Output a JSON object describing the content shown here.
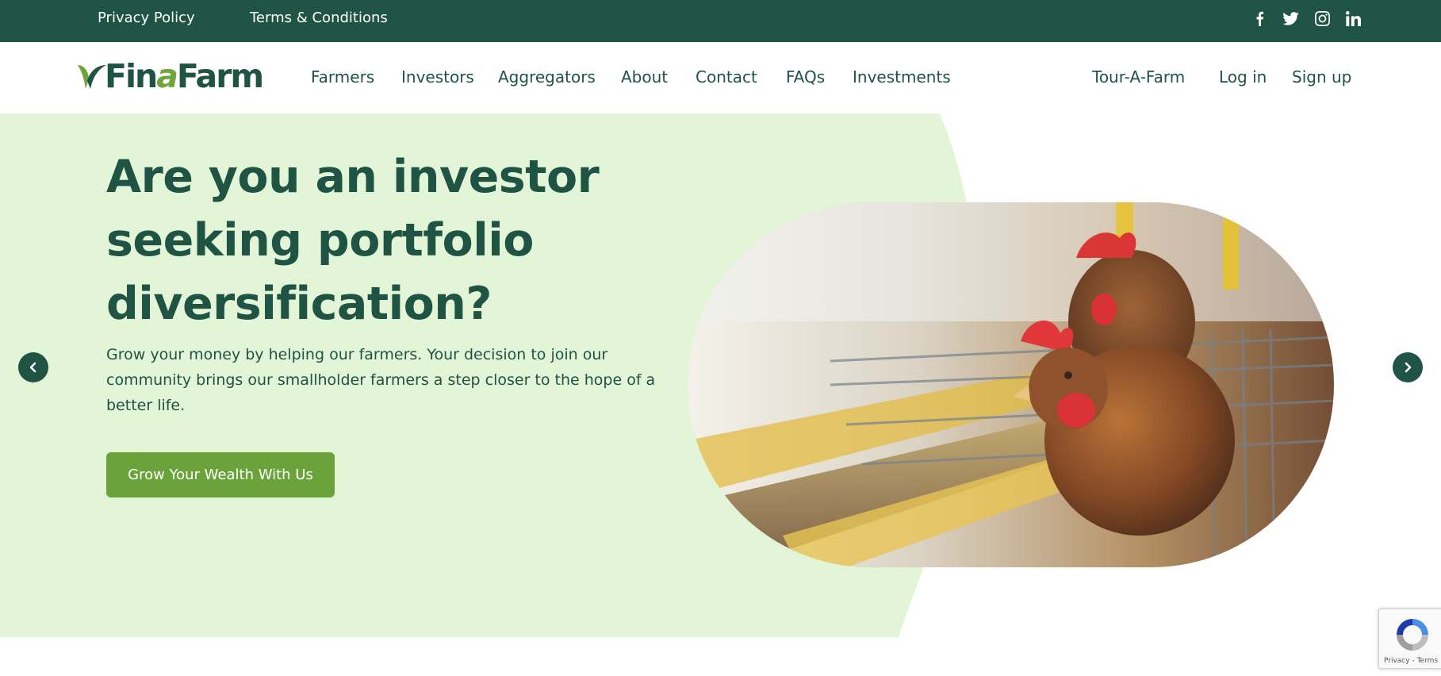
{
  "topbar": {
    "privacy_label": "Privacy Policy",
    "terms_label": "Terms & Conditions",
    "social": [
      "facebook-icon",
      "twitter-icon",
      "instagram-icon",
      "linkedin-icon"
    ]
  },
  "brand": {
    "name_part1": "Fin",
    "name_accent": "a",
    "name_part2": "Farm"
  },
  "nav": {
    "items": [
      "Farmers",
      "Investors",
      "Aggregators",
      "About",
      "Contact",
      "FAQs",
      "Investments"
    ],
    "right": [
      "Tour-A-Farm",
      "Log in",
      "Sign up"
    ]
  },
  "hero": {
    "headline_line1": "Are you an investor",
    "headline_line2": "seeking portfolio",
    "headline_line3": "diversification?",
    "body": "Grow your money by helping our farmers. Your decision to join our community brings our smallholder farmers a step closer to the hope of a better life.",
    "cta_label": "Grow Your Wealth With Us",
    "image_alt": "hens-in-cage-photo"
  },
  "recaptcha": {
    "privacy": "Privacy",
    "separator": " - ",
    "terms": "Terms"
  },
  "colors": {
    "primary": "#1f5343",
    "accent": "#6aa33a",
    "hero_bg": "#e3f5d7"
  }
}
